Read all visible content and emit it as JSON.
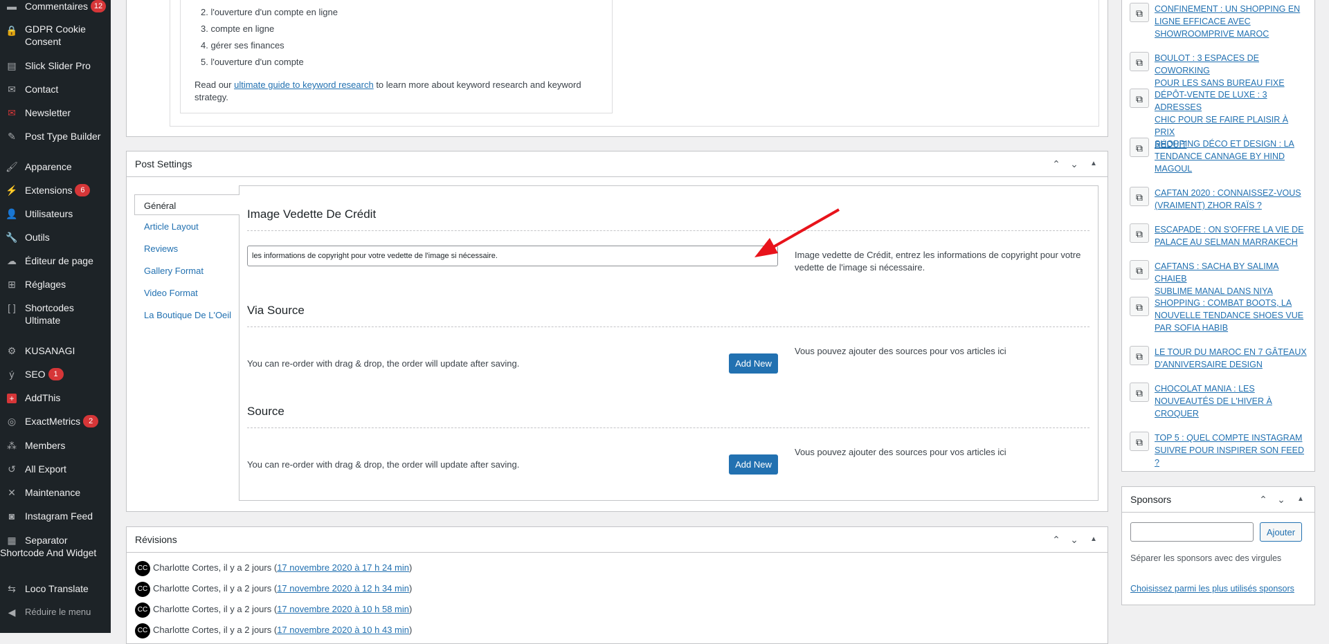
{
  "sidebar": {
    "items": [
      {
        "label": "Commentaires",
        "badge": "12",
        "icon": "comment-icon"
      },
      {
        "label": "GDPR Cookie Consent",
        "icon": "lock-icon"
      },
      {
        "label": "Slick Slider Pro",
        "icon": "slider-icon"
      },
      {
        "label": "Contact",
        "icon": "mail-icon"
      },
      {
        "label": "Newsletter",
        "icon": "newsletter-icon"
      },
      {
        "label": "Post Type Builder",
        "icon": "edit-icon"
      },
      {
        "label": "Apparence",
        "icon": "brush-icon"
      },
      {
        "label": "Extensions",
        "badge": "6",
        "icon": "plugin-icon"
      },
      {
        "label": "Utilisateurs",
        "icon": "user-icon"
      },
      {
        "label": "Outils",
        "icon": "wrench-icon"
      },
      {
        "label": "Éditeur de page",
        "icon": "cloud-icon"
      },
      {
        "label": "Réglages",
        "icon": "settings-icon"
      },
      {
        "label": "Shortcodes Ultimate",
        "icon": "brackets-icon"
      },
      {
        "label": "KUSANAGI",
        "icon": "gear-icon"
      },
      {
        "label": "SEO",
        "badge": "1",
        "icon": "yoast-icon"
      },
      {
        "label": "AddThis",
        "icon": "plus-icon"
      },
      {
        "label": "ExactMetrics",
        "badge": "2",
        "icon": "metrics-icon"
      },
      {
        "label": "Members",
        "icon": "members-icon"
      },
      {
        "label": "All Export",
        "icon": "export-icon"
      },
      {
        "label": "Maintenance",
        "icon": "tools-icon"
      },
      {
        "label": "Instagram Feed",
        "icon": "camera-icon"
      },
      {
        "label": "Separator Shortcode And Widget",
        "icon": "separator-icon"
      },
      {
        "label": "Loco Translate",
        "icon": "translate-icon"
      }
    ],
    "collapse_label": "Réduire le menu"
  },
  "keyword_panel": {
    "list": [
      "2. l'ouverture d'un compte en ligne",
      "3. compte en ligne",
      "4. gérer ses finances",
      "5. l'ouverture d'un compte"
    ],
    "read_prefix": "Read our ",
    "read_link": "ultimate guide to keyword research",
    "read_suffix_1": " to learn more about keyword research and keyword",
    "read_suffix_2": "strategy."
  },
  "post_settings": {
    "title": "Post Settings",
    "tabs": [
      "Général",
      "Article Layout",
      "Reviews",
      "Gallery Format",
      "Video Format",
      "La Boutique De L'Oeil"
    ],
    "credit": {
      "title": "Image Vedette De Crédit",
      "value": "les informations de copyright pour votre vedette de l'image si nécessaire.",
      "help_1": "Image vedette de Crédit, entrez les informations de copyright pour votre",
      "help_2": "vedette de l'image si nécessaire."
    },
    "via_source": {
      "title": "Via Source",
      "note": "You can re-order with drag & drop, the order will update after saving.",
      "button": "Add New",
      "help": "Vous pouvez ajouter des sources pour vos articles ici"
    },
    "source": {
      "title": "Source",
      "note": "You can re-order with drag & drop, the order will update after saving.",
      "button": "Add New",
      "help": "Vous pouvez ajouter des sources pour vos articles ici"
    }
  },
  "revisions": {
    "title": "Révisions",
    "rows": [
      {
        "initials": "CC",
        "author": "Charlotte Cortes, il y a 2 jours (",
        "link": "17 novembre 2020 à 17 h 24 min",
        "close": ")"
      },
      {
        "initials": "CC",
        "author": "Charlotte Cortes, il y a 2 jours (",
        "link": "17 novembre 2020 à 12 h 34 min",
        "close": ")"
      },
      {
        "initials": "CC",
        "author": "Charlotte Cortes, il y a 2 jours (",
        "link": "17 novembre 2020 à 10 h 58 min",
        "close": ")"
      },
      {
        "initials": "CC",
        "author": "Charlotte Cortes, il y a 2 jours (",
        "link": "17 novembre 2020 à 10 h 43 min",
        "close": ")"
      }
    ]
  },
  "related": {
    "items": [
      {
        "lines": [
          "CONFINEMENT : UN SHOPPING EN",
          "LIGNE EFFICACE AVEC",
          "SHOWROOMPRIVE MAROC"
        ]
      },
      {
        "lines": [
          "BOULOT : 3 ESPACES DE COWORKING",
          "POUR LES SANS BUREAU FIXE"
        ]
      },
      {
        "lines": [
          "DÉPÔT-VENTE DE LUXE : 3 ADRESSES",
          "CHIC POUR SE FAIRE PLAISIR À PRIX",
          "RÉDUIT"
        ]
      },
      {
        "lines": [
          "SHOPPING DÉCO ET DESIGN : LA",
          "TENDANCE CANNAGE BY HIND",
          "MAGOUL"
        ]
      },
      {
        "lines": [
          "CAFTAN 2020 : CONNAISSEZ-VOUS",
          "(VRAIMENT) ZHOR RAÏS ?"
        ]
      },
      {
        "lines": [
          "ESCAPADE : ON S'OFFRE LA VIE DE",
          "PALACE AU SELMAN MARRAKECH"
        ]
      },
      {
        "lines": [
          "CAFTANS : SACHA BY SALIMA CHAIEB",
          "SUBLIME MANAL DANS NIYA"
        ]
      },
      {
        "lines": [
          "SHOPPING : COMBAT BOOTS, LA",
          "NOUVELLE TENDANCE SHOES VUE",
          "PAR SOFIA HABIB"
        ]
      },
      {
        "lines": [
          "LE TOUR DU MAROC EN 7 GÂTEAUX",
          "D'ANNIVERSAIRE DESIGN"
        ]
      },
      {
        "lines": [
          "CHOCOLAT MANIA : LES",
          "NOUVEAUTÉS DE L'HIVER À",
          "CROQUER"
        ]
      },
      {
        "lines": [
          "TOP 5 : QUEL COMPTE INSTAGRAM",
          "SUIVRE POUR INSPIRER SON FEED ?"
        ]
      }
    ]
  },
  "sponsors": {
    "title": "Sponsors",
    "input_value": "",
    "button": "Ajouter",
    "hint": "Séparer les sponsors avec des virgules",
    "link": "Choisissez parmi les plus utilisés sponsors"
  },
  "colors": {
    "accent": "#2271b1",
    "sidebar_bg": "#1d2327",
    "badge": "#d63638",
    "arrow": "#e8131b"
  }
}
